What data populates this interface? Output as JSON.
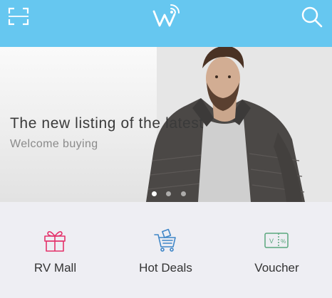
{
  "header": {
    "background": "#66c7f0",
    "left_icon": "scan-icon",
    "center_icon": "brand-logo",
    "right_icon": "search-icon"
  },
  "banner": {
    "title": "The new listing of the latest",
    "subtitle": "Welcome buying",
    "slide_count": 3,
    "active_slide": 1
  },
  "features": [
    {
      "label": "RV Mall",
      "icon": "gift-icon",
      "color": "#e4326b"
    },
    {
      "label": "Hot Deals",
      "icon": "shopping-cart-icon",
      "color": "#3f86c8"
    },
    {
      "label": "Voucher",
      "icon": "voucher-icon",
      "color": "#5aa77e"
    }
  ]
}
